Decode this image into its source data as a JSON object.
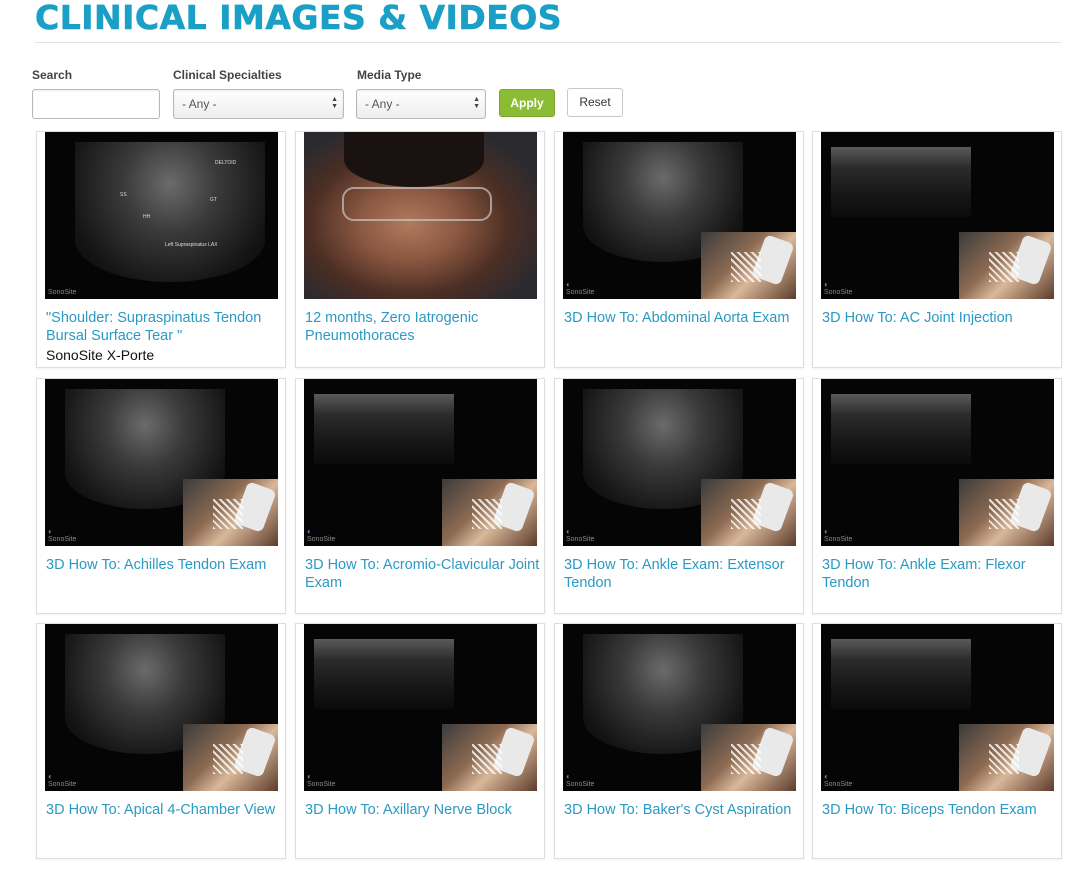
{
  "page": {
    "title": "CLINICAL IMAGES & VIDEOS"
  },
  "filters": {
    "search_label": "Search",
    "search_value": "",
    "specialties_label": "Clinical Specialties",
    "specialties_value": "- Any -",
    "media_label": "Media Type",
    "media_value": "- Any -",
    "apply_label": "Apply",
    "reset_label": "Reset"
  },
  "colors": {
    "accent": "#1aa0c6",
    "link": "#2a9ac4",
    "apply": "#8bbd34"
  },
  "cards": [
    {
      "title": "\"Shoulder: Supraspinatus Tendon Bursal Surface Tear \"",
      "subtitle": "SonoSite X-Porte",
      "thumb": "ultrasound-labeled"
    },
    {
      "title": "12 months, Zero Iatrogenic Pneumothoraces",
      "thumb": "person-video"
    },
    {
      "title": "3D How To: Abdominal Aorta Exam",
      "thumb": "ultrasound-3d"
    },
    {
      "title": "3D How To: AC Joint Injection",
      "thumb": "ultrasound-3d"
    },
    {
      "title": "3D How To: Achilles Tendon Exam",
      "thumb": "ultrasound-3d"
    },
    {
      "title": "3D How To: Acromio-Clavicular Joint Exam",
      "thumb": "ultrasound-3d"
    },
    {
      "title": "3D How To: Ankle Exam: Extensor Tendon",
      "thumb": "ultrasound-3d"
    },
    {
      "title": "3D How To: Ankle Exam: Flexor Tendon",
      "thumb": "ultrasound-3d"
    },
    {
      "title": "3D How To: Apical 4-Chamber View",
      "thumb": "ultrasound-3d"
    },
    {
      "title": "3D How To: Axillary Nerve Block",
      "thumb": "ultrasound-3d"
    },
    {
      "title": "3D How To: Baker's Cyst Aspiration",
      "thumb": "ultrasound-3d"
    },
    {
      "title": "3D How To: Biceps Tendon Exam",
      "thumb": "ultrasound-3d"
    }
  ],
  "thumb_text": {
    "logo": "SonoSite",
    "us_labels": [
      "DELTOID",
      "SS",
      "GT",
      "HH",
      "Left Supraspinatus LAX"
    ]
  }
}
